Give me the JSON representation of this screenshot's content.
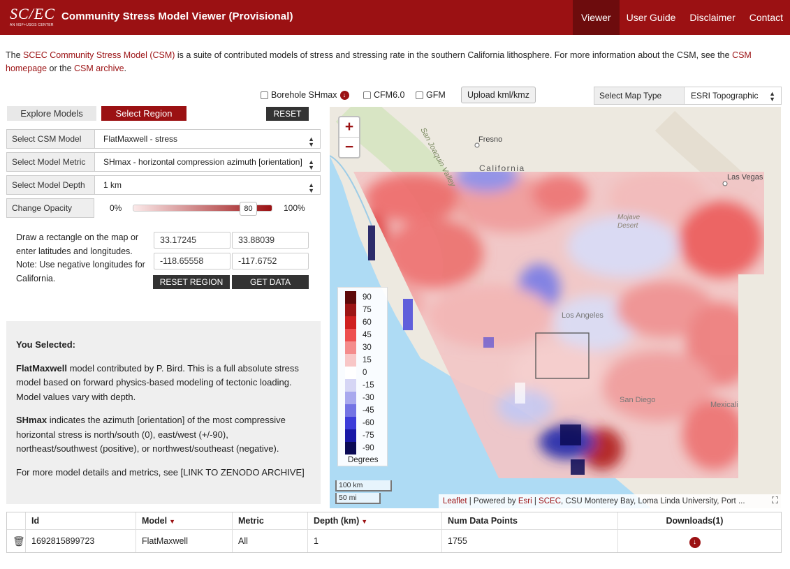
{
  "header": {
    "logo": {
      "mark": "SC/EC",
      "subtitle": "AN NSF+USGS CENTER"
    },
    "title": "Community Stress Model Viewer (Provisional)",
    "nav": [
      "Viewer",
      "User Guide",
      "Disclaimer",
      "Contact"
    ],
    "active_nav": "Viewer"
  },
  "intro": {
    "part1": "The ",
    "link1": "SCEC Community Stress Model (CSM)",
    "part2": " is a suite of contributed models of stress and stressing rate in the southern California lithosphere. For more information about the CSM, see the ",
    "link2": "CSM homepage",
    "part3": " or the ",
    "link3": "CSM archive",
    "part4": "."
  },
  "layers": {
    "borehole": "Borehole SHmax",
    "cfm": "CFM6.0",
    "gfm": "GFM",
    "upload": "Upload kml/kmz",
    "map_type_label": "Select Map Type",
    "map_type_value": "ESRI Topographic"
  },
  "panel": {
    "tab_explore": "Explore Models",
    "tab_select": "Select Region",
    "reset": "RESET",
    "model_label": "Select CSM Model",
    "model_value": "FlatMaxwell - stress",
    "metric_label": "Select Model Metric",
    "metric_value": "SHmax - horizontal compression azimuth [orientation]",
    "depth_label": "Select Model Depth",
    "depth_value": "1 km",
    "opacity_label": "Change Opacity",
    "opacity_min": "0%",
    "opacity_max": "100%",
    "opacity_value": "80",
    "draw_help": "Draw a rectangle on the map or enter latitudes and longitudes. Note: Use negative longitudes for California.",
    "lat1": "33.17245",
    "lat2": "33.88039",
    "lon1": "-118.65558",
    "lon2": "-117.6752",
    "reset_region": "RESET REGION",
    "get_data": "GET DATA"
  },
  "selected": {
    "heading": "You Selected:",
    "model_name": "FlatMaxwell",
    "model_desc": " model contributed by P. Bird. This is a full absolute stress model based on forward physics-based modeling of tectonic loading. Model values vary with depth.",
    "metric_name": "SHmax",
    "metric_desc": " indicates the azimuth [orientation] of the most compressive horizontal stress is north/south (0), east/west (+/-90), northeast/southwest (positive), or northwest/southeast (negative).",
    "more": "For more model details and metrics, see [LINK TO ZENODO ARCHIVE]"
  },
  "map": {
    "zoom_in": "+",
    "zoom_out": "−",
    "places": {
      "fresno": "Fresno",
      "california": "California",
      "las_vegas": "Las Vegas",
      "mojave": "Mojave Desert",
      "los_angeles": "Los Angeles",
      "san_diego": "San Diego",
      "mexicali": "Mexicali",
      "joaquin": "San Joaquin Valley"
    },
    "legend": {
      "title": "Degrees",
      "values": [
        "90",
        "75",
        "60",
        "45",
        "30",
        "15",
        "0",
        "-15",
        "-30",
        "-45",
        "-60",
        "-75",
        "-90"
      ],
      "colors": [
        "#5e0a0a",
        "#9c1515",
        "#cf2020",
        "#ee4f4f",
        "#f48c8c",
        "#f8c7c7",
        "#ffffff",
        "#d6d6f5",
        "#a9a9ee",
        "#7474e4",
        "#3c3cd9",
        "#1717a6",
        "#0a0a55"
      ]
    },
    "scale_km": "100 km",
    "scale_mi": "50 mi",
    "attribution": {
      "leaflet": "Leaflet",
      "powered": " | Powered by ",
      "esri": "Esri",
      "sep": " | ",
      "scec": "SCEC",
      "rest": ", CSU Monterey Bay, Loma Linda University, Port ..."
    }
  },
  "table": {
    "headers": [
      "",
      "Id",
      "Model",
      "Metric",
      "Depth (km)",
      "Num Data Points",
      "Downloads(1)"
    ],
    "row": {
      "id": "1692815899723",
      "model": "FlatMaxwell",
      "metric": "All",
      "depth": "1",
      "points": "1755"
    }
  },
  "colors": {
    "brand": "#9b1113",
    "brand_dark": "#6d0c0d"
  }
}
